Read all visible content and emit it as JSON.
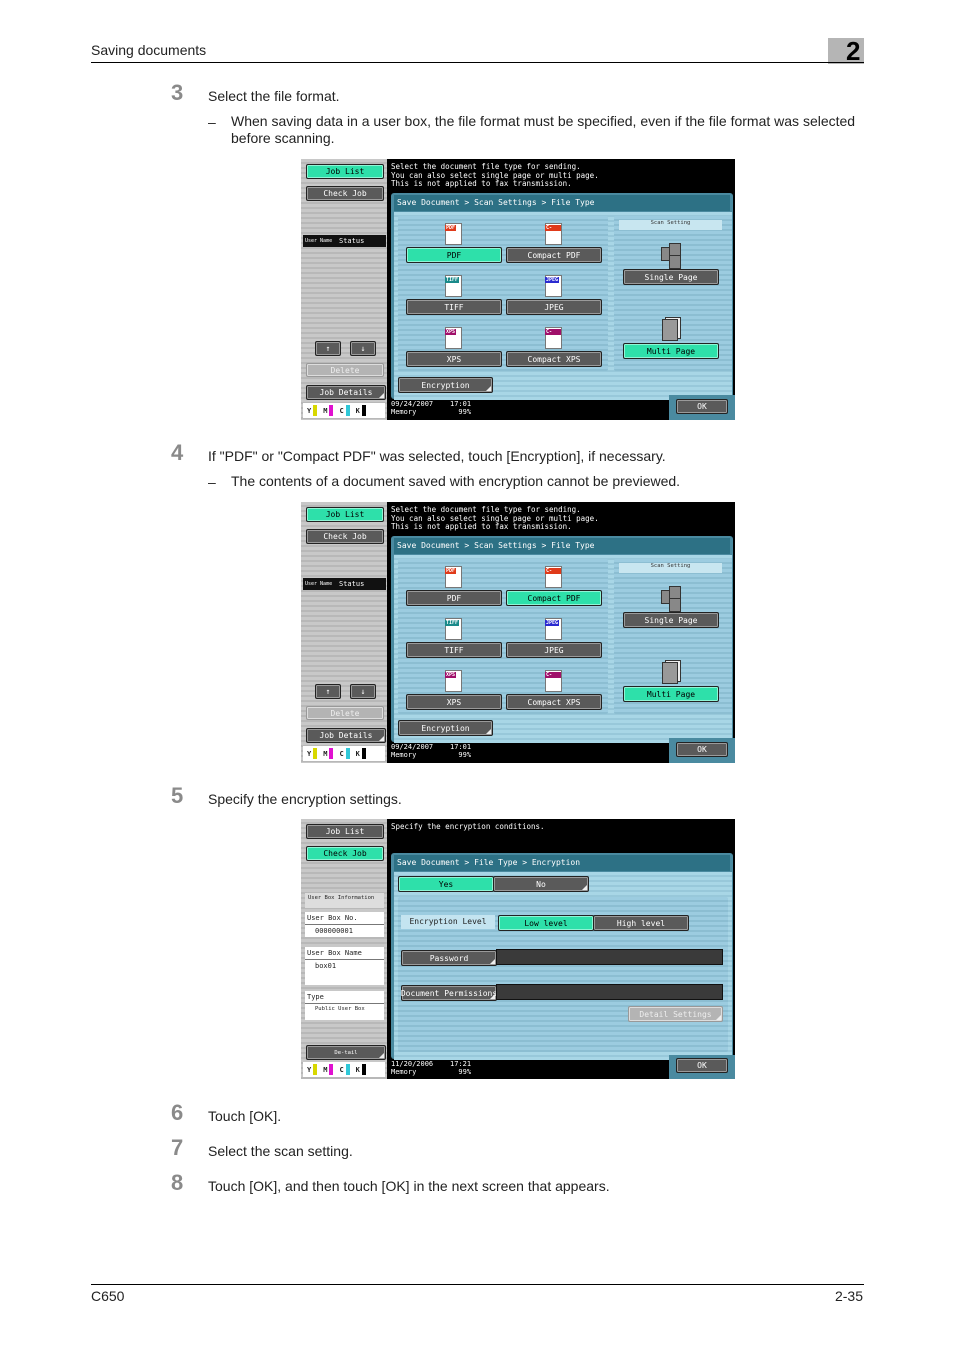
{
  "header": {
    "title": "Saving documents",
    "chapter": "2"
  },
  "steps": [
    {
      "num": "3",
      "text": "Select the file format.",
      "sub": "When saving data in a user box, the file format must be specified, even if the file format was selected before scanning."
    },
    {
      "num": "4",
      "text": "If \"PDF\" or \"Compact PDF\" was selected, touch [Encryption], if necessary.",
      "sub": "The contents of a document saved with encryption cannot be previewed."
    },
    {
      "num": "5",
      "text": "Specify the encryption settings."
    },
    {
      "num": "6",
      "text": "Touch [OK]."
    },
    {
      "num": "7",
      "text": "Select the scan setting."
    },
    {
      "num": "8",
      "text": "Touch [OK], and then touch [OK] in the next screen that appears."
    }
  ],
  "footer": {
    "model": "C650",
    "page": "2-35"
  },
  "dash": "–",
  "panel_filetype": {
    "message": "Select the document file type for sending.\nYou can also select single page or multi page.\nThis is not applied to fax transmission.",
    "breadcrumb": "Save Document > Scan Settings > File Type",
    "side": {
      "job_list": "Job List",
      "check_job": "Check Job",
      "list_user": "User Name",
      "list_status": "Status",
      "up": "↑",
      "down": "↓",
      "delete": "Delete",
      "job_details": "Job Details"
    },
    "formats": [
      {
        "tag": "PDF",
        "label": "PDF",
        "tag_color": "#e03a1a"
      },
      {
        "tag": "C-PDF",
        "label": "Compact PDF",
        "tag_color": "#e03a1a"
      },
      {
        "tag": "TIFF",
        "label": "TIFF",
        "tag_color": "#1a8a8a"
      },
      {
        "tag": "JPEG",
        "label": "JPEG",
        "tag_color": "#2a2ad0"
      },
      {
        "tag": "XPS",
        "label": "XPS",
        "tag_color": "#a0106a"
      },
      {
        "tag": "C-XPS",
        "label": "Compact XPS",
        "tag_color": "#a0106a"
      }
    ],
    "scan_setting_label": "Scan Setting",
    "single_page": "Single Page",
    "multi_page": "Multi Page",
    "encryption": "Encryption",
    "ok": "OK",
    "status": "09/24/2007    17:01\nMemory          99%",
    "toner": [
      "Y",
      "M",
      "C",
      "K"
    ]
  },
  "screen1_selected": {
    "format": "PDF",
    "page_mode": "Multi Page",
    "side_active": "Job List"
  },
  "screen2_selected": {
    "format": "Compact PDF",
    "page_mode": "Multi Page",
    "side_active": "Job List"
  },
  "panel_encryption": {
    "message": "Specify the encryption conditions.",
    "breadcrumb": "Save Document > File Type > Encryption",
    "side": {
      "job_list": "Job List",
      "check_job": "Check Job",
      "info_title": "User Box Information",
      "box_no_label": "User Box No.",
      "box_no_value": "000000001",
      "box_name_label": "User Box Name",
      "box_name_value": "box01",
      "type_label": "Type",
      "type_value": "Public User Box",
      "detail": "De-tail"
    },
    "yes": "Yes",
    "no": "No",
    "level_label": "Encryption Level",
    "low_level": "Low level",
    "high_level": "High level",
    "password": "Password",
    "doc_permissions": "Document Permissions",
    "detail_settings": "Detail Settings",
    "ok": "OK",
    "status": "11/20/2006    17:21\nMemory          99%",
    "toner": [
      "Y",
      "M",
      "C",
      "K"
    ]
  },
  "toner_colors": {
    "Y": "#d8d800",
    "M": "#e010d0",
    "C": "#30c8d8",
    "K": "#000000"
  }
}
